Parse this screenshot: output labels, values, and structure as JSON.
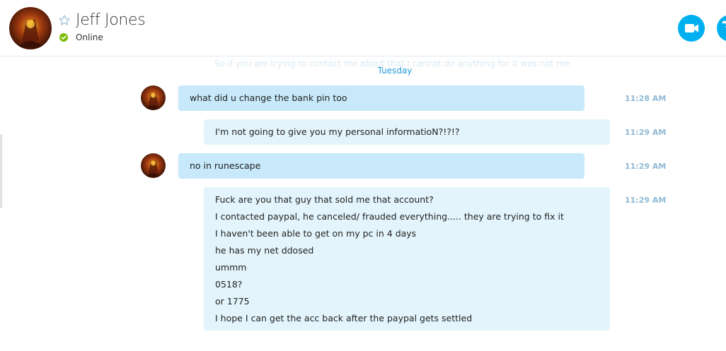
{
  "header": {
    "contact_name": "Jeff Jones",
    "status": "Online",
    "avatar_icon": "contact-avatar",
    "status_color": "#7dbb00",
    "accent_color": "#00aff0"
  },
  "conversation": {
    "ghost_line": "So if you are trying to contact me about that I cannot do anything for it was not me",
    "day_divider": "Tuesday",
    "messages": [
      {
        "direction": "incoming",
        "lines": [
          "what did u change the bank pin too"
        ],
        "time": "11:28 AM"
      },
      {
        "direction": "outgoing",
        "lines": [
          "I'm not going to give you my personal informatioN?!?!?"
        ],
        "time": "11:29 AM"
      },
      {
        "direction": "incoming",
        "lines": [
          "no in runescape"
        ],
        "time": "11:29 AM"
      },
      {
        "direction": "outgoing",
        "lines": [
          "Fuck are you that guy that sold me that account?",
          "I contacted paypal, he canceled/ frauded everything..... they are trying to fix it",
          "I haven't been able to get on my pc in 4 days",
          "he has my net ddosed",
          "ummm",
          "0518?",
          "or 1775",
          "I hope I can get the acc back after the paypal gets settled"
        ],
        "time": "11:29 AM"
      }
    ]
  }
}
